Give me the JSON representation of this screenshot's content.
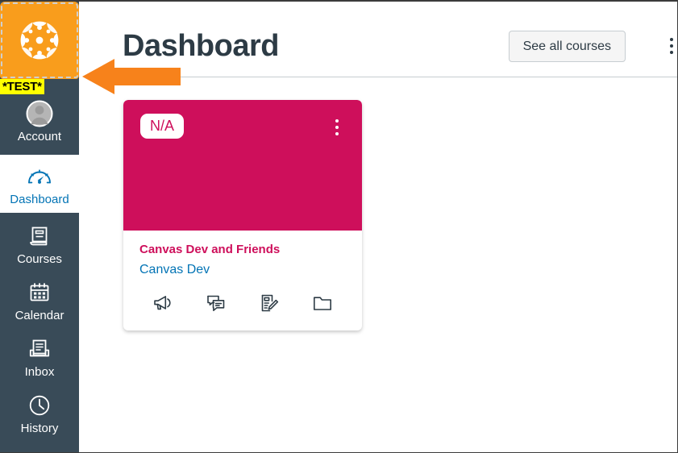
{
  "app": {
    "title": "Canvas Dashboard",
    "brand_color": "#F99D1C",
    "sidebar_color": "#394B58",
    "accent_blue": "#0374B5",
    "card_color": "#CE0F5B",
    "annotation_color": "#F7821B"
  },
  "sidebar": {
    "logo": {
      "name": "canvas-logo",
      "label": "Canvas"
    },
    "test_badge": {
      "label": "*TEST*",
      "background": "#FFFF00",
      "text_color": "#000000"
    },
    "items": [
      {
        "id": "account",
        "label": "Account",
        "icon": "user-avatar-icon",
        "active": false
      },
      {
        "id": "dashboard",
        "label": "Dashboard",
        "icon": "gauge-icon",
        "active": true
      },
      {
        "id": "courses",
        "label": "Courses",
        "icon": "book-icon",
        "active": false
      },
      {
        "id": "calendar",
        "label": "Calendar",
        "icon": "calendar-icon",
        "active": false
      },
      {
        "id": "inbox",
        "label": "Inbox",
        "icon": "inbox-tray-icon",
        "active": false
      },
      {
        "id": "history",
        "label": "History",
        "icon": "clock-icon",
        "active": false
      }
    ]
  },
  "header": {
    "title": "Dashboard",
    "see_all_courses_label": "See all courses",
    "options_menu": "dashboard-options-kebab"
  },
  "course_cards": [
    {
      "score_badge": "N/A",
      "course_name": "Canvas Dev and Friends",
      "term_name": "Canvas Dev",
      "header_color": "#CE0F5B",
      "actions": [
        {
          "id": "announcements",
          "icon": "megaphone-icon",
          "label": "Announcements"
        },
        {
          "id": "discussions",
          "icon": "discussion-icon",
          "label": "Discussions"
        },
        {
          "id": "assignments",
          "icon": "assignment-icon",
          "label": "Assignments"
        },
        {
          "id": "files",
          "icon": "folder-icon",
          "label": "Files"
        }
      ]
    }
  ],
  "annotation": {
    "type": "arrow",
    "direction": "left",
    "points_at": "canvas-logo",
    "color": "#F7821B"
  }
}
